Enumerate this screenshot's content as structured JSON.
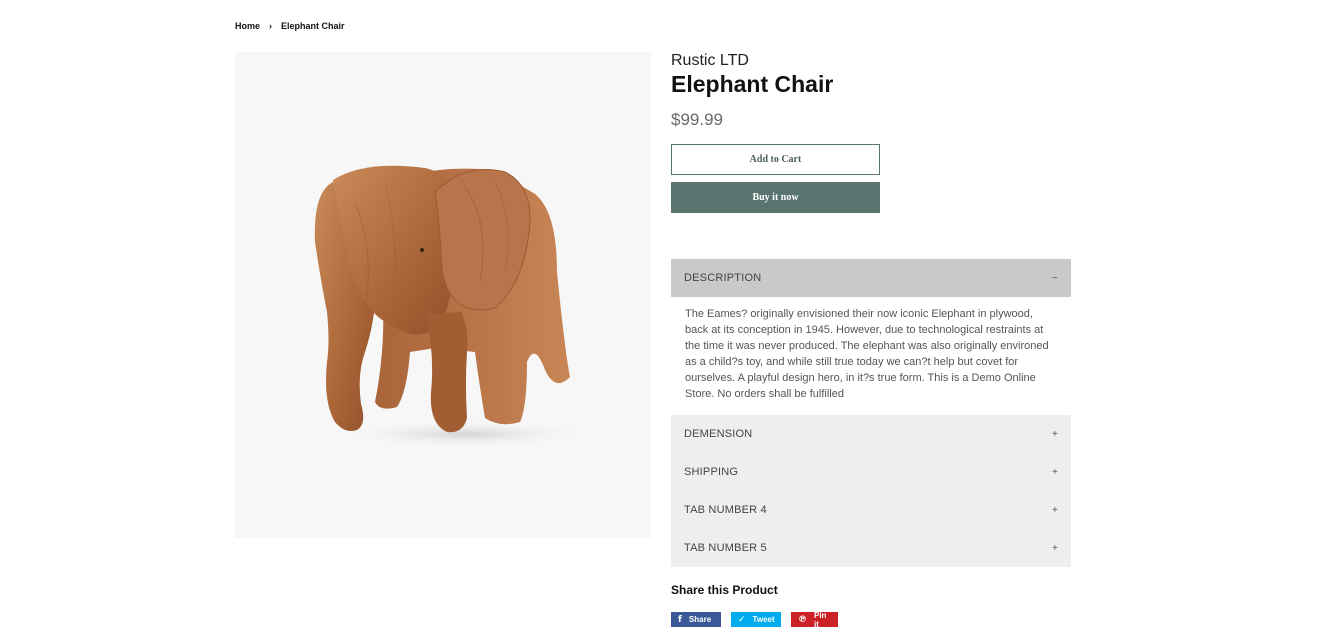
{
  "breadcrumb": {
    "home": "Home",
    "separator": "›",
    "current": "Elephant Chair"
  },
  "product": {
    "image_icon": "elephant-chair-image",
    "vendor": "Rustic LTD",
    "title": "Elephant Chair",
    "price": "$99.99",
    "add_to_cart_label": "Add to Cart",
    "buy_now_label": "Buy it now"
  },
  "tabs": [
    {
      "label": "DESCRIPTION",
      "toggle": "−",
      "open": true,
      "body": "The Eames? originally envisioned their now iconic Elephant in plywood, back at its conception in 1945. However, due to technological restraints at the time it was never produced. The elephant was also originally environed as a child?s toy, and while still true today we can?t help but covet for ourselves. A playful design hero, in it?s true form. This is a Demo Online Store. No orders shall be fulfilled"
    },
    {
      "label": "DEMENSION",
      "toggle": "+",
      "open": false
    },
    {
      "label": "SHIPPING",
      "toggle": "+",
      "open": false
    },
    {
      "label": "TAB NUMBER 4",
      "toggle": "+",
      "open": false
    },
    {
      "label": "TAB NUMBER 5",
      "toggle": "+",
      "open": false
    }
  ],
  "share": {
    "title": "Share this Product",
    "facebook": {
      "icon": "f",
      "label": "Share",
      "color": "#3b5998"
    },
    "twitter": {
      "icon": "✓",
      "label": "Tweet",
      "color": "#00aced"
    },
    "pinterest": {
      "icon": "℗",
      "label": "Pin it",
      "color": "#cb2127"
    }
  },
  "colors": {
    "accent": "#5a7570",
    "tab_open_bg": "#c9c9c9",
    "tab_closed_bg": "#eeeeee"
  }
}
